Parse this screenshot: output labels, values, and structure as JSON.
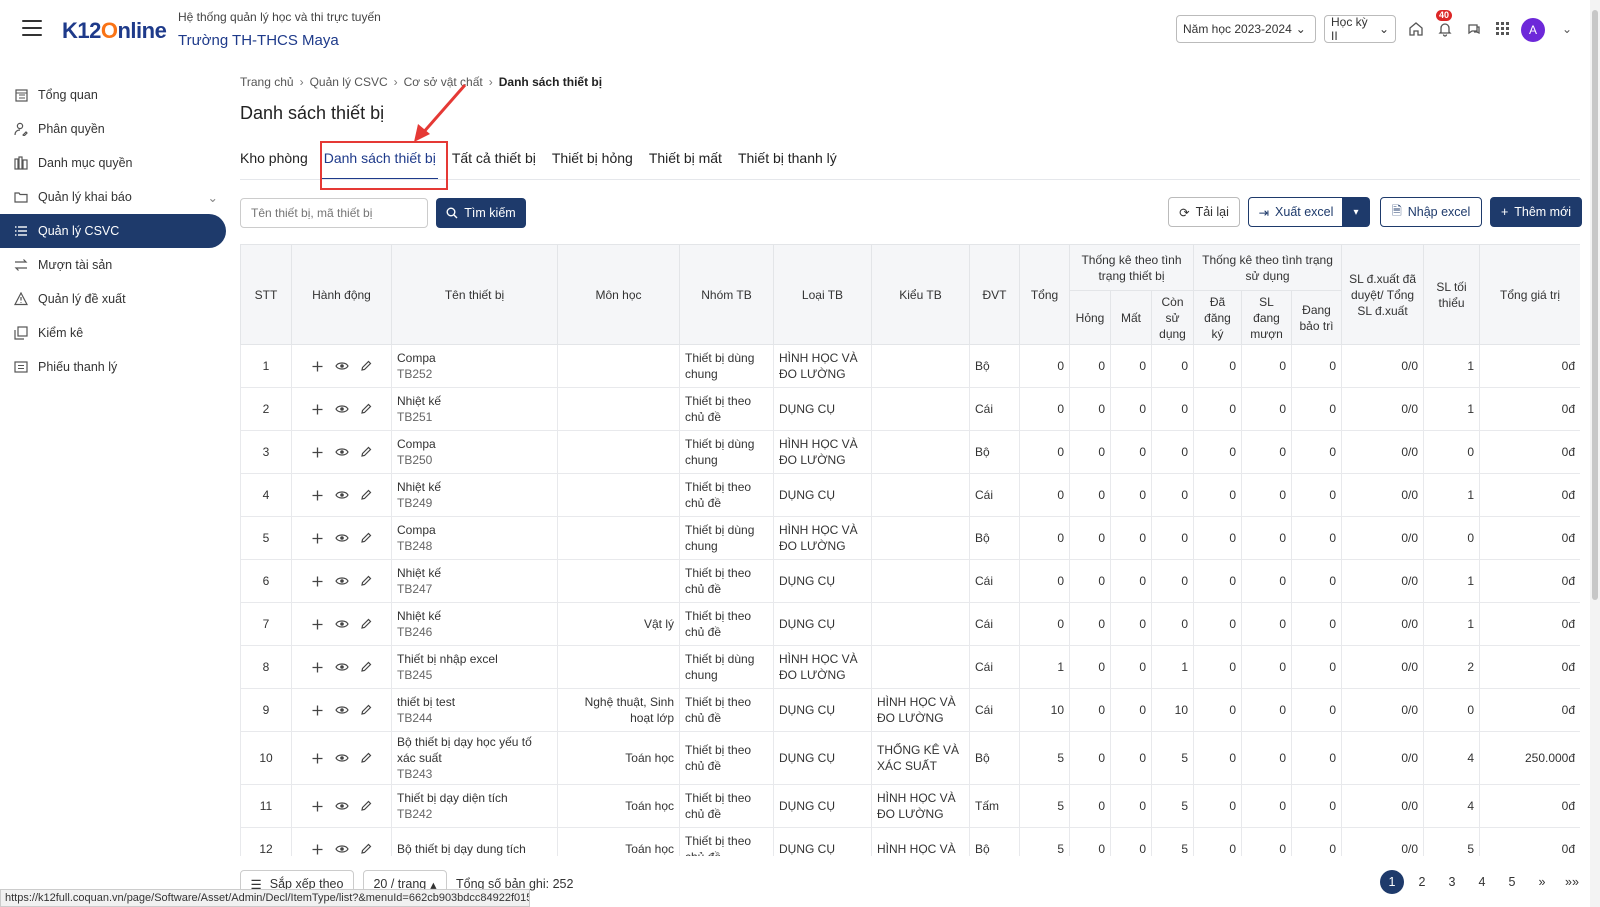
{
  "header": {
    "sys_title": "Hệ thống quản lý học và thi trực tuyến",
    "school_name": "Trường TH-THCS Maya",
    "logo_k12": "K12",
    "logo_o": "O",
    "logo_nline": "nline",
    "year_select": "Năm học 2023-2024",
    "term_select": "Học kỳ II",
    "notification_count": "40",
    "avatar_letter": "A",
    "accent": "#1e3a6b"
  },
  "sidebar": {
    "items": [
      {
        "label": "Tổng quan",
        "icon": "dashboard-icon"
      },
      {
        "label": "Phân quyền",
        "icon": "user-permission-icon"
      },
      {
        "label": "Danh mục quyền",
        "icon": "books-icon"
      },
      {
        "label": "Quản lý khai báo",
        "icon": "folder-icon"
      },
      {
        "label": "Quản lý CSVC",
        "icon": "list-icon"
      },
      {
        "label": "Mượn tài sản",
        "icon": "exchange-icon"
      },
      {
        "label": "Quản lý đề xuất",
        "icon": "warning-icon"
      },
      {
        "label": "Kiểm kê",
        "icon": "copy-icon"
      },
      {
        "label": "Phiếu thanh lý",
        "icon": "receipt-icon"
      }
    ]
  },
  "breadcrumb": [
    "Trang chủ",
    "Quản lý CSVC",
    "Cơ sở vật chất",
    "Danh sách thiết bị"
  ],
  "page_title": "Danh sách thiết bị",
  "tabs": [
    "Kho phòng",
    "Danh sách thiết bị",
    "Tất cả thiết bị",
    "Thiết bị hỏng",
    "Thiết bị mất",
    "Thiết bị thanh lý"
  ],
  "toolbar": {
    "search_placeholder": "Tên thiết bị, mã thiết bị",
    "search_btn": "Tìm kiếm",
    "reload_btn": "Tải lại",
    "export_btn": "Xuất excel",
    "import_btn": "Nhập excel",
    "add_btn": "Thêm mới"
  },
  "table": {
    "headers": {
      "stt": "STT",
      "action": "Hành động",
      "name": "Tên thiết bị",
      "subject": "Môn học",
      "group": "Nhóm TB",
      "type": "Loại TB",
      "kind": "Kiểu TB",
      "unit": "ĐVT",
      "total": "Tổng",
      "status_group": "Thống kê theo tình trạng thiết bị",
      "broken": "Hỏng",
      "lost": "Mất",
      "usable": "Còn sử dụng",
      "usage_group": "Thống kê theo tình trạng sử dụng",
      "registered": "Đã đăng ký",
      "borrowing": "SL đang mượn",
      "maintaining": "Đang bảo trì",
      "proposal": "SL đ.xuất đã duyệt/ Tổng SL đ.xuất",
      "min": "SL tối thiểu",
      "value": "Tổng giá trị"
    },
    "rows": [
      {
        "stt": "1",
        "name": "Compa",
        "code": "TB252",
        "subject": "",
        "group": "Thiết bị dùng chung",
        "type": "HÌNH HỌC VÀ ĐO LƯỜNG",
        "kind": "",
        "unit": "Bộ",
        "total": "0",
        "broken": "0",
        "lost": "0",
        "usable": "0",
        "registered": "0",
        "borrowing": "0",
        "maintaining": "0",
        "proposal": "0/0",
        "min": "1",
        "value": "0đ"
      },
      {
        "stt": "2",
        "name": "Nhiệt kế",
        "code": "TB251",
        "subject": "",
        "group": "Thiết bị theo chủ đề",
        "type": "DỤNG CỤ",
        "kind": "",
        "unit": "Cái",
        "total": "0",
        "broken": "0",
        "lost": "0",
        "usable": "0",
        "registered": "0",
        "borrowing": "0",
        "maintaining": "0",
        "proposal": "0/0",
        "min": "1",
        "value": "0đ"
      },
      {
        "stt": "3",
        "name": "Compa",
        "code": "TB250",
        "subject": "",
        "group": "Thiết bị dùng chung",
        "type": "HÌNH HỌC VÀ ĐO LƯỜNG",
        "kind": "",
        "unit": "Bộ",
        "total": "0",
        "broken": "0",
        "lost": "0",
        "usable": "0",
        "registered": "0",
        "borrowing": "0",
        "maintaining": "0",
        "proposal": "0/0",
        "min": "0",
        "value": "0đ"
      },
      {
        "stt": "4",
        "name": "Nhiệt kế",
        "code": "TB249",
        "subject": "",
        "group": "Thiết bị theo chủ đề",
        "type": "DỤNG CỤ",
        "kind": "",
        "unit": "Cái",
        "total": "0",
        "broken": "0",
        "lost": "0",
        "usable": "0",
        "registered": "0",
        "borrowing": "0",
        "maintaining": "0",
        "proposal": "0/0",
        "min": "1",
        "value": "0đ"
      },
      {
        "stt": "5",
        "name": "Compa",
        "code": "TB248",
        "subject": "",
        "group": "Thiết bị dùng chung",
        "type": "HÌNH HỌC VÀ ĐO LƯỜNG",
        "kind": "",
        "unit": "Bộ",
        "total": "0",
        "broken": "0",
        "lost": "0",
        "usable": "0",
        "registered": "0",
        "borrowing": "0",
        "maintaining": "0",
        "proposal": "0/0",
        "min": "0",
        "value": "0đ"
      },
      {
        "stt": "6",
        "name": "Nhiệt kế",
        "code": "TB247",
        "subject": "",
        "group": "Thiết bị theo chủ đề",
        "type": "DỤNG CỤ",
        "kind": "",
        "unit": "Cái",
        "total": "0",
        "broken": "0",
        "lost": "0",
        "usable": "0",
        "registered": "0",
        "borrowing": "0",
        "maintaining": "0",
        "proposal": "0/0",
        "min": "1",
        "value": "0đ"
      },
      {
        "stt": "7",
        "name": "Nhiệt kế",
        "code": "TB246",
        "subject": "Vật lý",
        "group": "Thiết bị theo chủ đề",
        "type": "DỤNG CỤ",
        "kind": "",
        "unit": "Cái",
        "total": "0",
        "broken": "0",
        "lost": "0",
        "usable": "0",
        "registered": "0",
        "borrowing": "0",
        "maintaining": "0",
        "proposal": "0/0",
        "min": "1",
        "value": "0đ"
      },
      {
        "stt": "8",
        "name": "Thiết bị nhập excel",
        "code": "TB245",
        "subject": "",
        "group": "Thiết bị dùng chung",
        "type": "HÌNH HỌC VÀ ĐO LƯỜNG",
        "kind": "",
        "unit": "Cái",
        "total": "1",
        "broken": "0",
        "lost": "0",
        "usable": "1",
        "registered": "0",
        "borrowing": "0",
        "maintaining": "0",
        "proposal": "0/0",
        "min": "2",
        "value": "0đ"
      },
      {
        "stt": "9",
        "name": "thiết bị test",
        "code": "TB244",
        "subject": "Nghệ thuật, Sinh hoạt lớp",
        "group": "Thiết bị theo chủ đề",
        "type": "DỤNG CỤ",
        "kind": "HÌNH HỌC VÀ ĐO LƯỜNG",
        "unit": "Cái",
        "total": "10",
        "broken": "0",
        "lost": "0",
        "usable": "10",
        "registered": "0",
        "borrowing": "0",
        "maintaining": "0",
        "proposal": "0/0",
        "min": "0",
        "value": "0đ"
      },
      {
        "stt": "10",
        "name": "Bộ thiết bị dạy học yếu tố xác suất",
        "code": "TB243",
        "subject": "Toán học",
        "group": "Thiết bị theo chủ đề",
        "type": "DỤNG CỤ",
        "kind": "THỐNG KÊ VÀ XÁC SUẤT",
        "unit": "Bộ",
        "total": "5",
        "broken": "0",
        "lost": "0",
        "usable": "5",
        "registered": "0",
        "borrowing": "0",
        "maintaining": "0",
        "proposal": "0/0",
        "min": "4",
        "value": "250.000đ"
      },
      {
        "stt": "11",
        "name": "Thiết bị dạy diện tích",
        "code": "TB242",
        "subject": "Toán học",
        "group": "Thiết bị theo chủ đề",
        "type": "DỤNG CỤ",
        "kind": "HÌNH HỌC VÀ ĐO LƯỜNG",
        "unit": "Tấm",
        "total": "5",
        "broken": "0",
        "lost": "0",
        "usable": "5",
        "registered": "0",
        "borrowing": "0",
        "maintaining": "0",
        "proposal": "0/0",
        "min": "4",
        "value": "0đ"
      },
      {
        "stt": "12",
        "name": "Bộ thiết bị dạy dung tích",
        "code": "",
        "subject": "Toán học",
        "group": "Thiết bị theo chủ đề",
        "type": "DỤNG CỤ",
        "kind": "HÌNH HỌC VÀ",
        "unit": "Bộ",
        "total": "5",
        "broken": "0",
        "lost": "0",
        "usable": "5",
        "registered": "0",
        "borrowing": "0",
        "maintaining": "0",
        "proposal": "0/0",
        "min": "5",
        "value": "0đ"
      }
    ]
  },
  "footer": {
    "sort_btn": "Sắp xếp theo",
    "per_page": "20 / trang",
    "total_records": "Tổng số bản ghi: 252",
    "pages": [
      "1",
      "2",
      "3",
      "4",
      "5"
    ],
    "next": "»",
    "last": "»»"
  },
  "status_url": "https://k12full.coquan.vn/page/Software/Asset/Admin/Decl/ItemType/list?&menuId=662cb903bdcc84922f015a08&..."
}
